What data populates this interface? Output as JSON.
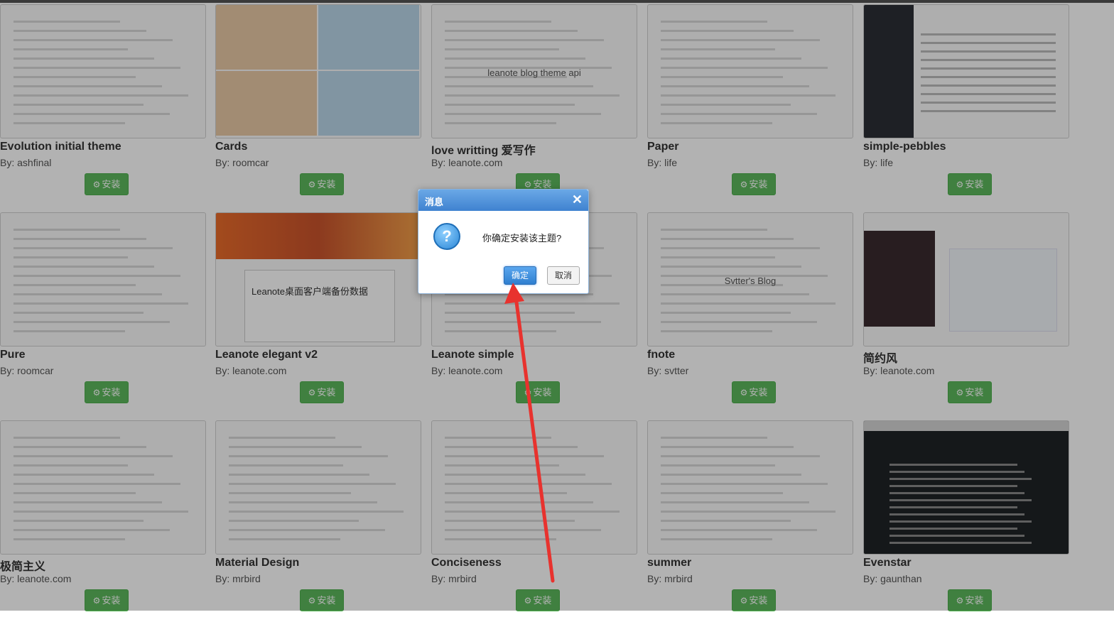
{
  "themes": [
    {
      "name": "Evolution initial theme",
      "author": "By: ashfinal",
      "install": "安装",
      "style": "light"
    },
    {
      "name": "Cards",
      "author": "By: roomcar",
      "install": "安装",
      "style": "cards"
    },
    {
      "name": "love writting 爱写作",
      "author": "By: leanote.com",
      "install": "安装",
      "style": "light",
      "caption": "leanote blog theme api"
    },
    {
      "name": "Paper",
      "author": "By: life",
      "install": "安装",
      "style": "light"
    },
    {
      "name": "simple-pebbles",
      "author": "By: life",
      "install": "安装",
      "style": "pebbles"
    },
    {
      "name": "Pure",
      "author": "By: roomcar",
      "install": "安装",
      "style": "light"
    },
    {
      "name": "Leanote elegant v2",
      "author": "By: leanote.com",
      "install": "安装",
      "style": "orange",
      "caption": "Leanote桌面客户端备份数据"
    },
    {
      "name": "Leanote simple",
      "author": "By: leanote.com",
      "install": "安装",
      "style": "light"
    },
    {
      "name": "fnote",
      "author": "By: svtter",
      "install": "安装",
      "style": "light",
      "caption": "Svtter's Blog"
    },
    {
      "name": "简约风",
      "author": "By: leanote.com",
      "install": "安装",
      "style": "code"
    },
    {
      "name": "极简主义",
      "author": "By: leanote.com",
      "install": "安装",
      "style": "light"
    },
    {
      "name": "Material Design",
      "author": "By: mrbird",
      "install": "安装",
      "style": "light"
    },
    {
      "name": "Conciseness",
      "author": "By: mrbird",
      "install": "安装",
      "style": "light"
    },
    {
      "name": "summer",
      "author": "By: mrbird",
      "install": "安装",
      "style": "light"
    },
    {
      "name": "Evenstar",
      "author": "By: gaunthan",
      "install": "安装",
      "style": "dark"
    }
  ],
  "dialog": {
    "title": "消息",
    "message": "你确定安装该主题?",
    "ok": "确定",
    "cancel": "取消",
    "close": "✕",
    "icon": "question-icon"
  },
  "colors": {
    "install": "#5cb85c",
    "dialog_header": "#3f82d0",
    "arrow": "#e8322e"
  }
}
